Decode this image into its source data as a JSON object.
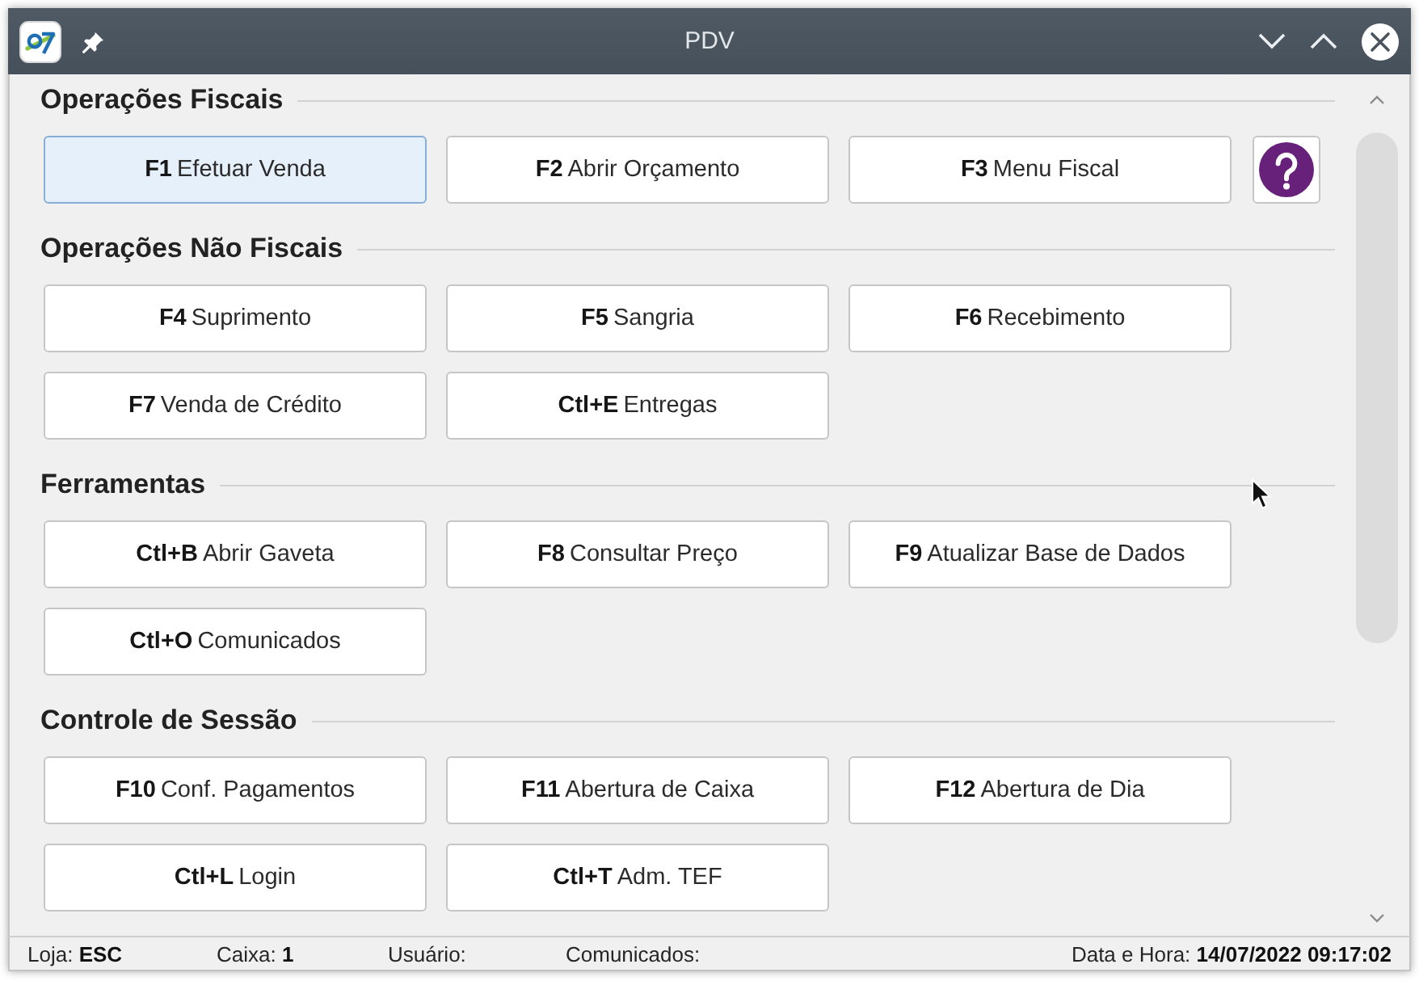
{
  "window": {
    "title": "PDV"
  },
  "sections": [
    {
      "title": "Operações Fiscais",
      "rows": [
        [
          {
            "kind": "command",
            "key": "F1",
            "label": "Efetuar Venda",
            "focused": true
          },
          {
            "kind": "command",
            "key": "F2",
            "label": "Abrir Orçamento",
            "focused": false
          },
          {
            "kind": "command",
            "key": "F3",
            "label": "Menu Fiscal",
            "focused": false
          },
          {
            "kind": "help",
            "focused": false
          }
        ]
      ]
    },
    {
      "title": "Operações Não Fiscais",
      "rows": [
        [
          {
            "kind": "command",
            "key": "F4",
            "label": "Suprimento",
            "focused": false
          },
          {
            "kind": "command",
            "key": "F5",
            "label": "Sangria",
            "focused": false
          },
          {
            "kind": "command",
            "key": "F6",
            "label": "Recebimento",
            "focused": false
          }
        ],
        [
          {
            "kind": "command",
            "key": "F7",
            "label": "Venda de Crédito",
            "focused": false
          },
          {
            "kind": "command",
            "key": "Ctl+E",
            "label": "Entregas",
            "focused": false
          }
        ]
      ]
    },
    {
      "title": "Ferramentas",
      "rows": [
        [
          {
            "kind": "command",
            "key": "Ctl+B",
            "label": "Abrir Gaveta",
            "focused": false
          },
          {
            "kind": "command",
            "key": "F8",
            "label": "Consultar Preço",
            "focused": false
          },
          {
            "kind": "command",
            "key": "F9",
            "label": "Atualizar Base de Dados",
            "focused": false
          }
        ],
        [
          {
            "kind": "command",
            "key": "Ctl+O",
            "label": "Comunicados",
            "focused": false
          }
        ]
      ]
    },
    {
      "title": "Controle de Sessão",
      "rows": [
        [
          {
            "kind": "command",
            "key": "F10",
            "label": "Conf. Pagamentos",
            "focused": false
          },
          {
            "kind": "command",
            "key": "F11",
            "label": "Abertura de Caixa",
            "focused": false
          },
          {
            "kind": "command",
            "key": "F12",
            "label": "Abertura de Dia",
            "focused": false
          }
        ],
        [
          {
            "kind": "command",
            "key": "Ctl+L",
            "label": "Login",
            "focused": false
          },
          {
            "kind": "command",
            "key": "Ctl+T",
            "label": "Adm. TEF",
            "focused": false
          }
        ]
      ]
    }
  ],
  "status_bar": [
    {
      "label": "Loja:",
      "value": "ESC"
    },
    {
      "label": "Caixa:",
      "value": "1"
    },
    {
      "label": "Usuário:"
    },
    {
      "label": "Comunicados:"
    },
    {
      "label": "Data e Hora:",
      "value": "14/07/2022 09:17:02"
    }
  ]
}
